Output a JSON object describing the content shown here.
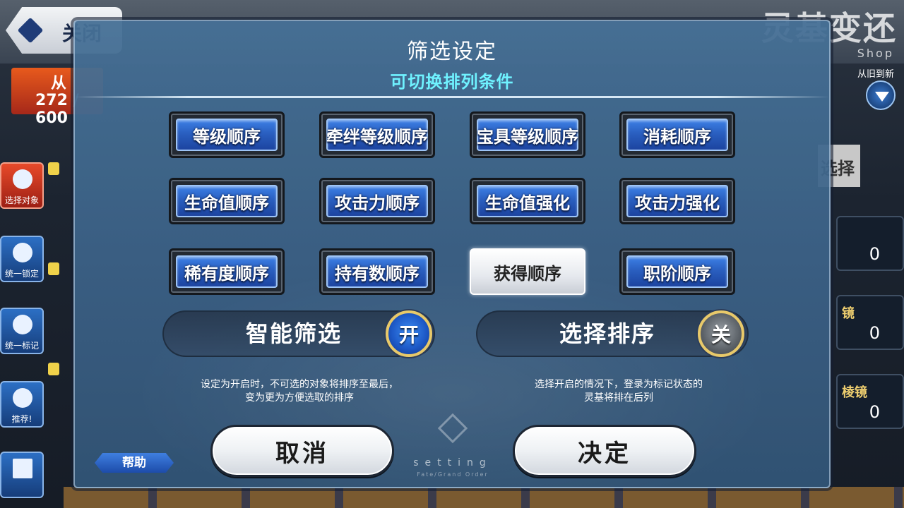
{
  "background": {
    "close_label": "关闭",
    "title": "灵基变还",
    "shop_label": "Shop",
    "order_label": "从旧到新",
    "red_panel": {
      "label": "从",
      "count": "272 / 600"
    },
    "side_buttons": [
      {
        "label": "选择对象"
      },
      {
        "label": "统一锁定"
      },
      {
        "label": "统一标记"
      },
      {
        "label": "推荐!"
      }
    ],
    "right_cards": [
      {
        "title": "",
        "count": "0"
      },
      {
        "title": "镜",
        "count": "0"
      },
      {
        "title": "棱镜",
        "count": "0"
      }
    ],
    "select_label": "选择"
  },
  "modal": {
    "title": "筛选设定",
    "subtitle": "可切换排列条件",
    "sort_options": [
      {
        "label": "等级顺序",
        "active": false
      },
      {
        "label": "牵绊等级顺序",
        "active": false
      },
      {
        "label": "宝具等级顺序",
        "active": false
      },
      {
        "label": "消耗顺序",
        "active": false
      },
      {
        "label": "生命值顺序",
        "active": false
      },
      {
        "label": "攻击力顺序",
        "active": false
      },
      {
        "label": "生命值强化",
        "active": false
      },
      {
        "label": "攻击力强化",
        "active": false
      },
      {
        "label": "稀有度顺序",
        "active": false
      },
      {
        "label": "持有数顺序",
        "active": false
      },
      {
        "label": "获得顺序",
        "active": true
      },
      {
        "label": "职阶顺序",
        "active": false
      }
    ],
    "smart_filter": {
      "label": "智能筛选",
      "state": "开",
      "description_line1": "设定为开启时，不可选的对象将排序至最后，",
      "description_line2": "变为更为方便选取的排序"
    },
    "select_sort": {
      "label": "选择排序",
      "state": "关",
      "description_line1": "选择开启的情况下，登录为标记状态的",
      "description_line2": "灵基将排在后列"
    },
    "cancel_label": "取消",
    "confirm_label": "决定",
    "help_label": "帮助",
    "logo_text": "setting",
    "logo_subtext": "Fate/Grand Order"
  }
}
